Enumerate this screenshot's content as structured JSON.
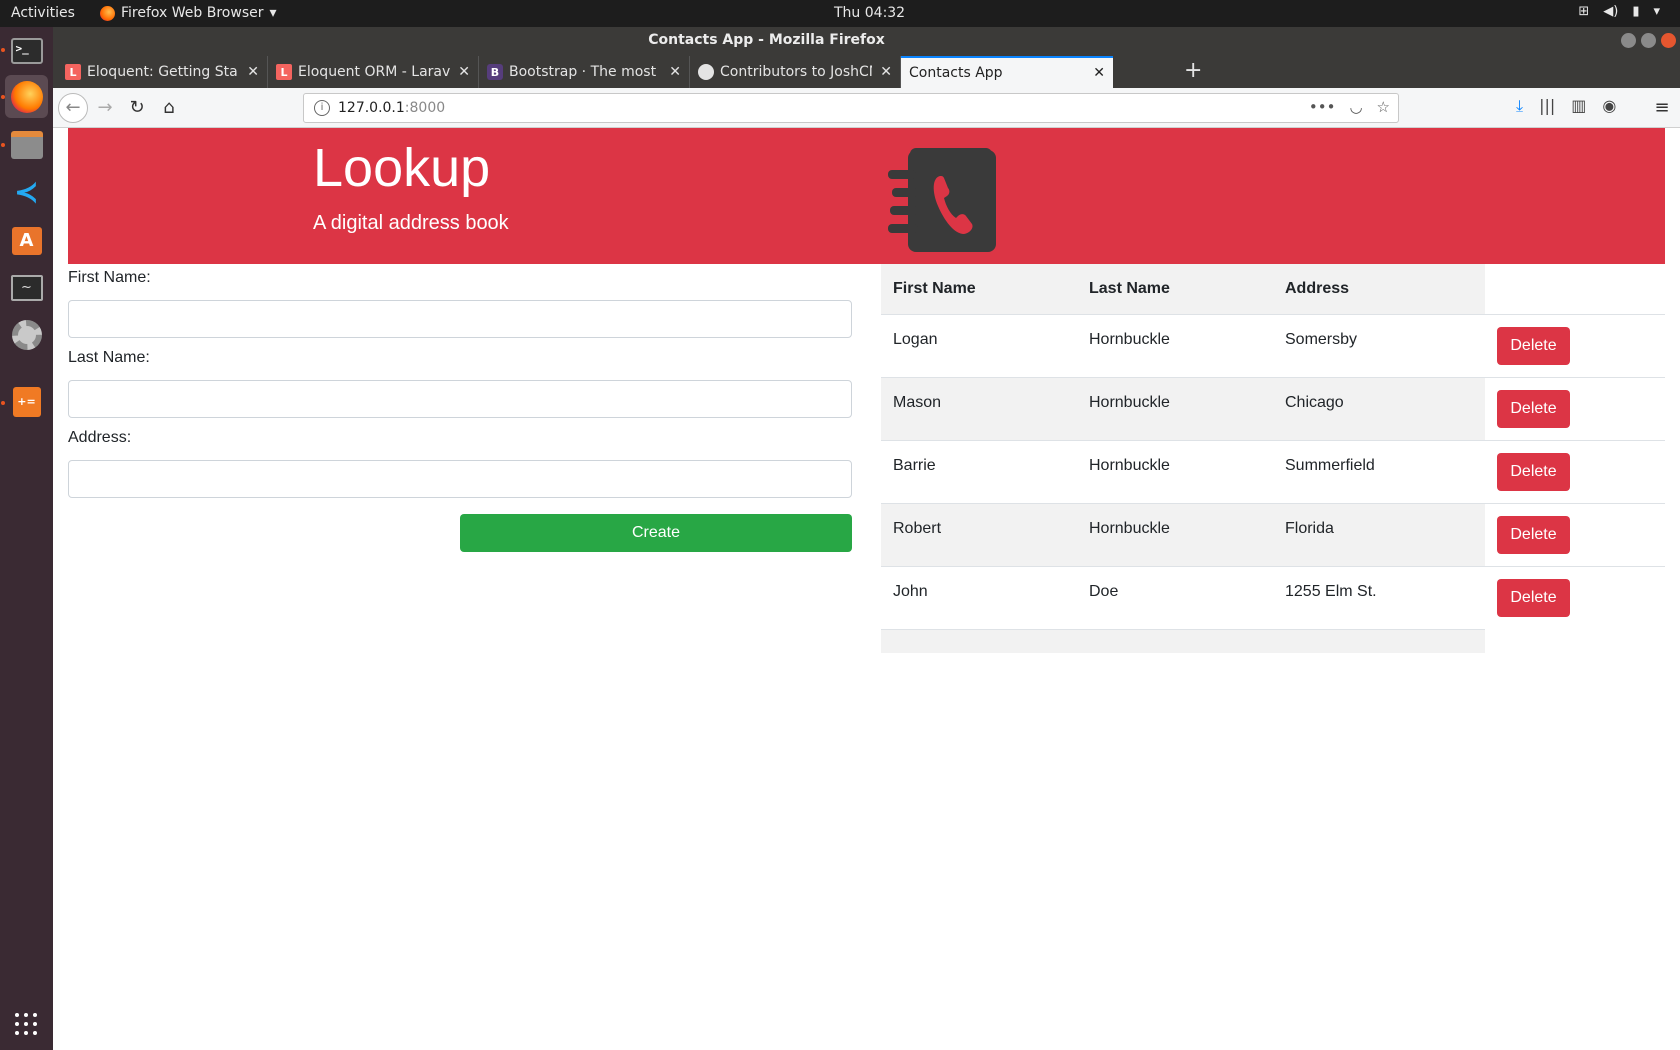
{
  "os": {
    "activities": "Activities",
    "app_menu": "Firefox Web Browser",
    "clock": "Thu 04:32"
  },
  "window": {
    "title": "Contacts App - Mozilla Firefox"
  },
  "tabs": [
    {
      "label": "Eloquent: Getting Starte",
      "favicon": "laravel-icon"
    },
    {
      "label": "Eloquent ORM - Laravel -",
      "favicon": "laravel-icon"
    },
    {
      "label": "Bootstrap · The most po",
      "favicon": "bootstrap-icon"
    },
    {
      "label": "Contributors to JoshCM",
      "favicon": "github-icon"
    },
    {
      "label": "Contacts App",
      "favicon": "none"
    }
  ],
  "url": {
    "host": "127.0.0.1",
    "port": ":8000"
  },
  "hero": {
    "title": "Lookup",
    "subtitle": "A digital address book",
    "logo_icon": "address-book-phone-icon"
  },
  "form": {
    "first_name_label": "First Name:",
    "last_name_label": "Last Name:",
    "address_label": "Address:",
    "first_name_value": "",
    "last_name_value": "",
    "address_value": "",
    "create_label": "Create"
  },
  "table": {
    "headers": [
      "First Name",
      "Last Name",
      "Address"
    ],
    "delete_label": "Delete",
    "rows": [
      [
        "Logan",
        "Hornbuckle",
        "Somersby"
      ],
      [
        "Mason",
        "Hornbuckle",
        "Chicago"
      ],
      [
        "Barrie",
        "Hornbuckle",
        "Summerfield"
      ],
      [
        "Robert",
        "Hornbuckle",
        "Florida"
      ],
      [
        "John",
        "Doe",
        "1255 Elm St."
      ]
    ]
  },
  "colors": {
    "brand_red": "#dc3545",
    "create_green": "#28a745",
    "logo_gray": "#3a3a3a"
  }
}
